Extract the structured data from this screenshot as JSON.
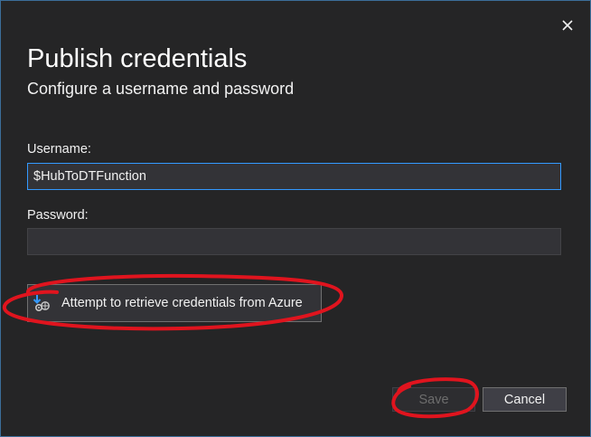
{
  "dialog": {
    "title": "Publish credentials",
    "subtitle": "Configure a username and password",
    "close_icon": "close-icon"
  },
  "form": {
    "username_label": "Username:",
    "username_value": "$HubToDTFunction",
    "password_label": "Password:",
    "password_value": ""
  },
  "retrieve_button": {
    "label": "Attempt to retrieve credentials from Azure",
    "icon": "retrieve-credentials-icon"
  },
  "footer": {
    "save_label": "Save",
    "save_enabled": false,
    "cancel_label": "Cancel"
  },
  "colors": {
    "background": "#252526",
    "border_accent": "#3c6e9a",
    "focus_border": "#3399ff",
    "annotation_red": "#e0141e"
  }
}
